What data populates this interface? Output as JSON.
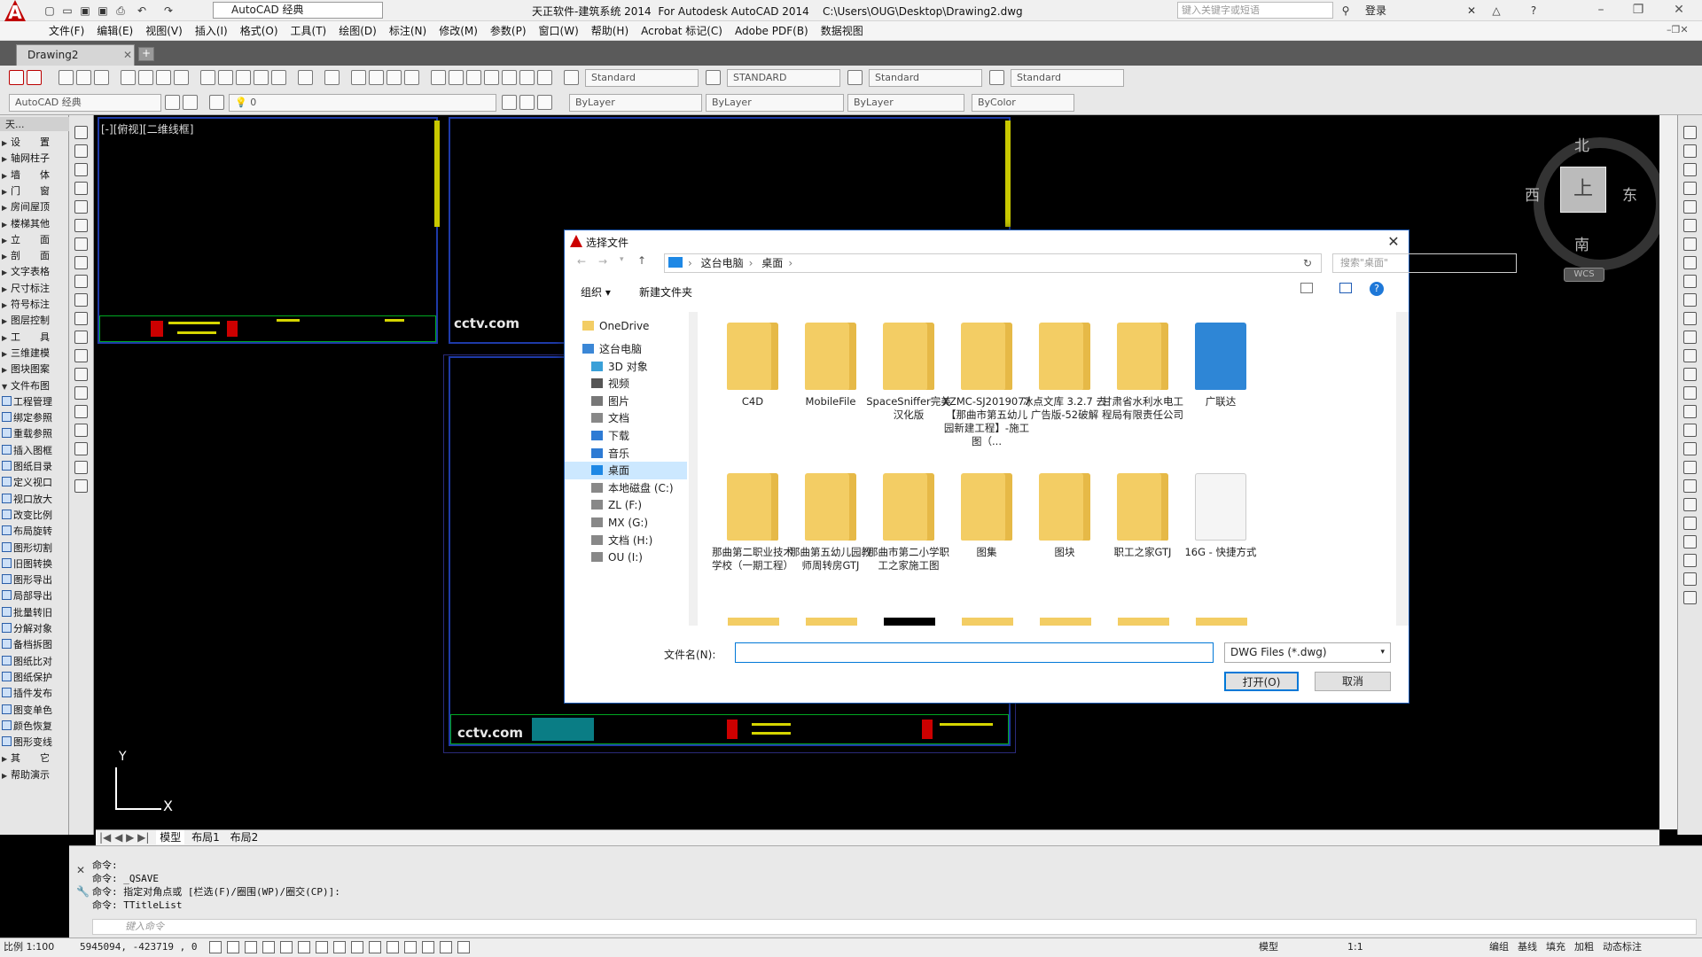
{
  "title_bar": {
    "workspace": "AutoCAD 经典",
    "app_title": "天正软件-建筑系统 2014  For Autodesk AutoCAD 2014    C:\\Users\\OUG\\Desktop\\Drawing2.dwg",
    "search_placeholder": "键入关键字或短语",
    "login": "登录"
  },
  "menu": [
    "文件(F)",
    "编辑(E)",
    "视图(V)",
    "插入(I)",
    "格式(O)",
    "工具(T)",
    "绘图(D)",
    "标注(N)",
    "修改(M)",
    "参数(P)",
    "窗口(W)",
    "帮助(H)",
    "Acrobat 标记(C)",
    "Adobe PDF(B)",
    "数据视图"
  ],
  "document_tab": "Drawing2",
  "toolbar": {
    "text_style": "Standard",
    "dim_style": "STANDARD",
    "table_style": "Standard",
    "mleader_style": "Standard",
    "workspace2": "AutoCAD 经典",
    "layer": "0",
    "color": "ByLayer",
    "linetype": "ByLayer",
    "lineweight": "ByLayer",
    "plotstyle": "ByColor"
  },
  "left_panel": {
    "title": "天...",
    "items": [
      "设　　置",
      "轴网柱子",
      "墙　　体",
      "门　　窗",
      "房间屋顶",
      "楼梯其他",
      "立　　面",
      "剖　　面",
      "文字表格",
      "尺寸标注",
      "符号标注",
      "图层控制",
      "工　　具",
      "三维建模",
      "图块图案",
      "文件布图",
      "工程管理",
      "绑定参照",
      "重载参照",
      "插入图框",
      "图纸目录",
      "定义视口",
      "视口放大",
      "改变比例",
      "布局旋转",
      "图形切割",
      "旧图转换",
      "图形导出",
      "局部导出",
      "批量转旧",
      "分解对象",
      "备档拆图",
      "图纸比对",
      "图纸保护",
      "插件发布",
      "图变单色",
      "颜色恢复",
      "图形变线",
      "其　　它",
      "帮助演示"
    ]
  },
  "canvas": {
    "view_label": "[-][俯视][二维线框]",
    "cctv": "cctv.com",
    "compass": {
      "n": "北",
      "s": "南",
      "e": "东",
      "w": "西",
      "top": "上"
    },
    "wcs": "WCS",
    "axis_y": "Y",
    "axis_x": "X"
  },
  "layout_tabs": [
    "模型",
    "布局1",
    "布局2"
  ],
  "command": {
    "lines": [
      "命令:",
      "命令: _QSAVE",
      "命令: 指定对角点或 [栏选(F)/圈围(WP)/圈交(CP)]:",
      "命令: TTitleList"
    ],
    "placeholder": "键入命令"
  },
  "status": {
    "scale": "比例 1:100",
    "coords": "5945094, -423719 , 0",
    "model": "模型",
    "anno_scale": "1:1",
    "right_items": [
      "编组",
      "基线",
      "填充",
      "加粗",
      "动态标注"
    ]
  },
  "dialog": {
    "title": "选择文件",
    "breadcrumb": [
      "这台电脑",
      "桌面"
    ],
    "search_placeholder": "搜索\"桌面\"",
    "organize": "组织",
    "new_folder": "新建文件夹",
    "nav": [
      "OneDrive",
      "这台电脑",
      "3D 对象",
      "视频",
      "图片",
      "文档",
      "下载",
      "音乐",
      "桌面",
      "本地磁盘 (C:)",
      "ZL (F:)",
      "MX (G:)",
      "文档 (H:)",
      "OU (I:)"
    ],
    "files_row1": [
      "C4D",
      "MobileFile",
      "SpaceSniffer完美汉化版",
      "XZMC-SJ2019077【那曲市第五幼儿园新建工程】-施工图（...",
      "冰点文库 3.2.7 去广告版-52破解",
      "甘肃省水利水电工程局有限责任公司",
      "广联达"
    ],
    "files_row2": [
      "那曲第二职业技术学校（一期工程）",
      "那曲第五幼儿园教师周转房GTJ",
      "那曲市第二小学职工之家施工图",
      "图集",
      "图块",
      "职工之家GTJ",
      "16G - 快捷方式"
    ],
    "filename_label": "文件名(N):",
    "filename_value": "",
    "filetype": "DWG Files (*.dwg)",
    "open": "打开(O)",
    "cancel": "取消"
  }
}
